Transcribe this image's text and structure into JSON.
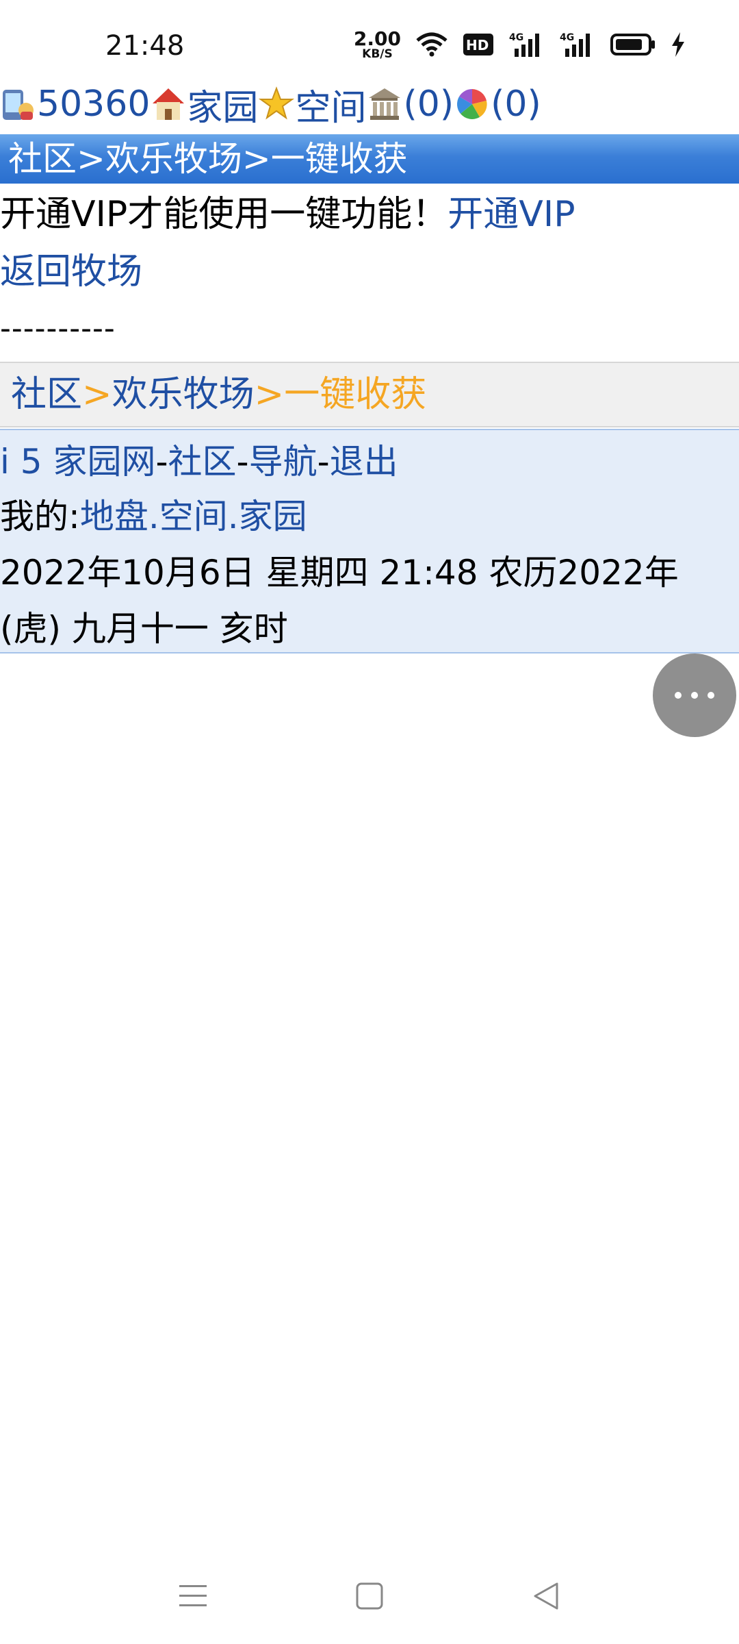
{
  "status_bar": {
    "time": "21:48",
    "speed_value": "2.00",
    "speed_unit": "KB/S",
    "icons": [
      "wifi-icon",
      "hd-icon",
      "signal-4g-icon",
      "signal-4g-icon",
      "battery-icon",
      "charging-icon"
    ]
  },
  "userline": {
    "user_id": "50360",
    "home_label": "家园",
    "space_label": "空间",
    "bank_count": "(0)",
    "game_count": "(0)",
    "icons": [
      "user-phone-icon",
      "home-icon",
      "star-icon",
      "bank-icon",
      "colorful-ball-icon"
    ]
  },
  "title_bar": {
    "text": "社区>欢乐牧场>一键收获"
  },
  "content": {
    "vip_message": "开通VIP才能使用一键功能！",
    "vip_link": "开通VIP",
    "back_link": "返回牧场",
    "separator": "----------"
  },
  "breadcrumb": {
    "item1": "社区",
    "sep1": ">",
    "item2": "欢乐牧场",
    "sep2": ">",
    "current": "一键收获"
  },
  "footer": {
    "site_link": "i 5 家园网",
    "dash1": "-",
    "community_link": "社区",
    "dash2": "-",
    "nav_link": "导航",
    "dash3": "-",
    "logout_link": "退出",
    "mine_label": "我的:",
    "land_link": "地盘",
    "dot1": ".",
    "space_link": "空间",
    "dot2": ".",
    "home_link": "家园",
    "datetime_line1": "2022年10月6日  星期四  21:48  农历2022年",
    "datetime_line2": "(虎)  九月十一  亥时"
  },
  "colors": {
    "link": "#1f4fa3",
    "breadcrumb_current": "#f5a623",
    "title_bar": "#3b7fd8",
    "footer_bg": "#e4edf9"
  }
}
